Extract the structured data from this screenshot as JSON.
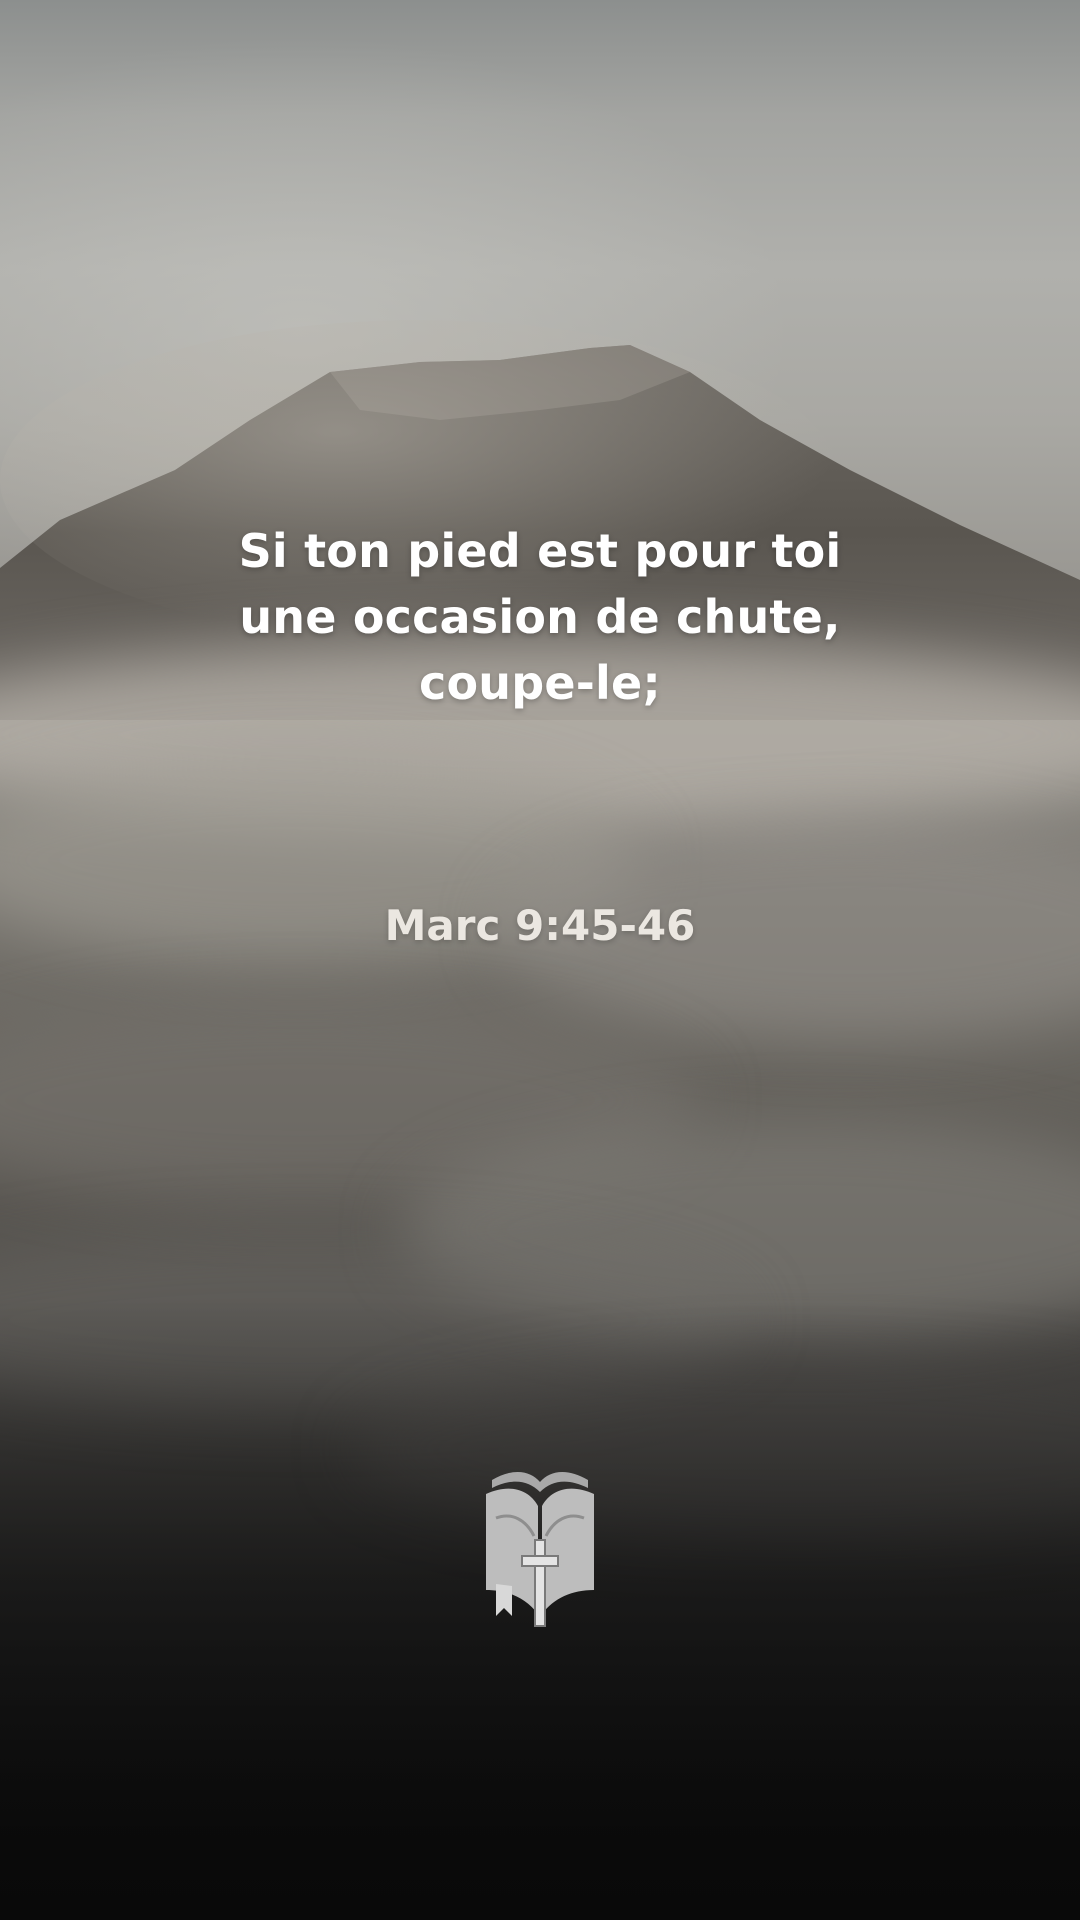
{
  "verse": {
    "lines": [
      "Si ton pied est pour toi",
      "une occasion de chute,",
      "coupe-le;"
    ]
  },
  "reference": "Marc 9:45-46",
  "logo": {
    "icon": "bible-book-cross-logo-icon",
    "color": "#bfbfbf"
  },
  "colors": {
    "text": "#ffffff",
    "reference_text": "#ebe7e1"
  }
}
